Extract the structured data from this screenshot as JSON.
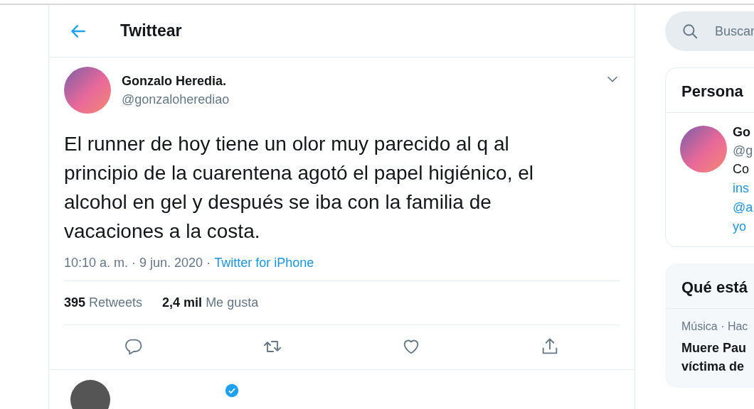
{
  "header": {
    "title": "Twittear"
  },
  "tweet": {
    "author": {
      "name": "Gonzalo Heredia.",
      "handle": "@gonzaloherediao"
    },
    "text": "El runner de hoy tiene un olor muy parecido al q al principio de la cuarentena agotó el papel higiénico, el alcohol en gel y después se iba con la familia de vacaciones a la costa.",
    "time": "10:10 a. m. · 9 jun. 2020",
    "separator": "·",
    "source": "Twitter for iPhone",
    "stats": [
      {
        "count": "395",
        "label": "Retweets"
      },
      {
        "count": "2,4 mil",
        "label": "Me gusta"
      }
    ],
    "actions": [
      {
        "kind": "reply"
      },
      {
        "kind": "retweet"
      },
      {
        "kind": "like"
      },
      {
        "kind": "share"
      }
    ]
  },
  "reply_preview": {
    "verified": true
  },
  "sidebar": {
    "search": {
      "placeholder": "Buscar"
    },
    "people": {
      "title": "Persona",
      "person": {
        "name": "Go",
        "handle": "@g",
        "bio": [
          {
            "text": "Co",
            "link": false
          },
          {
            "text": "ins",
            "link": true
          },
          {
            "text": "@a",
            "link": true
          },
          {
            "text": "yo",
            "link": true
          }
        ]
      }
    },
    "trends": {
      "title": "Qué está",
      "items": [
        {
          "meta": "Música · Hac",
          "title_lines": [
            "Muere Pau",
            "víctima de"
          ]
        }
      ]
    }
  }
}
